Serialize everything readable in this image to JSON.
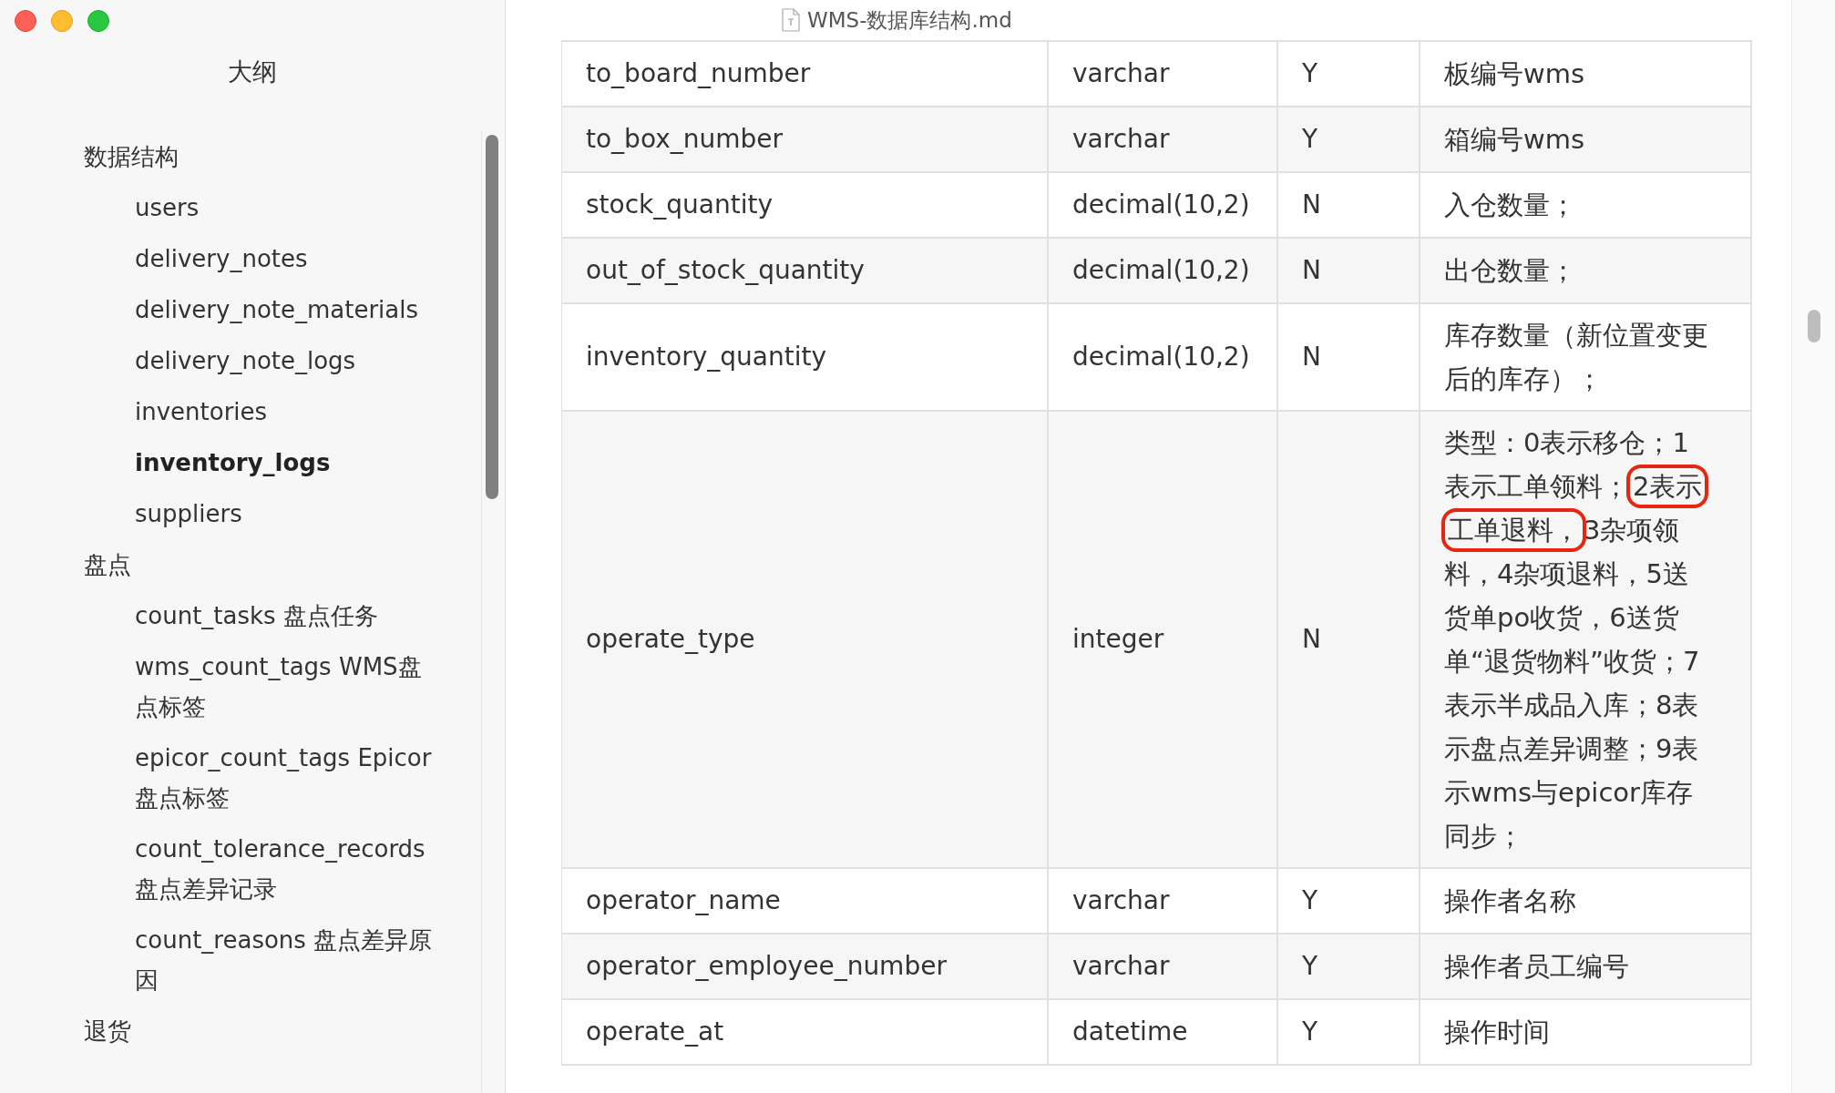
{
  "window": {
    "title": "WMS-数据库结构.md"
  },
  "sidebar": {
    "title": "大纲",
    "items": [
      {
        "label": "数据结构",
        "selected": false,
        "children": [
          {
            "label": "users",
            "selected": false
          },
          {
            "label": "delivery_notes",
            "selected": false
          },
          {
            "label": "delivery_note_materials",
            "selected": false
          },
          {
            "label": "delivery_note_logs",
            "selected": false
          },
          {
            "label": "inventories",
            "selected": false
          },
          {
            "label": "inventory_logs",
            "selected": true
          },
          {
            "label": "suppliers",
            "selected": false
          }
        ]
      },
      {
        "label": "盘点",
        "selected": false,
        "children": [
          {
            "label": "count_tasks 盘点任务",
            "selected": false
          },
          {
            "label": "wms_count_tags WMS盘点标签",
            "selected": false
          },
          {
            "label": "epicor_count_tags Epicor盘点标签",
            "selected": false
          },
          {
            "label": "count_tolerance_records 盘点差异记录",
            "selected": false
          },
          {
            "label": "count_reasons 盘点差异原因",
            "selected": false
          }
        ]
      },
      {
        "label": "退货",
        "selected": false
      }
    ]
  },
  "table": {
    "rows": [
      {
        "field": "to_board_number",
        "type": "varchar",
        "nullable": "Y",
        "description": "板编号wms"
      },
      {
        "field": "to_box_number",
        "type": "varchar",
        "nullable": "Y",
        "description": "箱编号wms"
      },
      {
        "field": "stock_quantity",
        "type": "decimal(10,2)",
        "nullable": "N",
        "description": "入仓数量；"
      },
      {
        "field": "out_of_stock_quantity",
        "type": "decimal(10,2)",
        "nullable": "N",
        "description": "出仓数量；"
      },
      {
        "field": "inventory_quantity",
        "type": "decimal(10,2)",
        "nullable": "N",
        "description": "库存数量（新位置变更后的库存）；"
      },
      {
        "field": "operate_type",
        "type": "integer",
        "nullable": "N",
        "description_parts": [
          {
            "text": "类型：0表示移仓；1表示工单领料；",
            "highlighted": false
          },
          {
            "text": "2表示",
            "highlighted": true
          },
          {
            "text": "工单退料，",
            "highlighted": true
          },
          {
            "text": "3杂项领料，4杂项退料，5送货单po收货，6送货单“退货物料”收货；7表示半成品入库；8表示盘点差异调整；9表示wms与epicor库存同步；",
            "highlighted": false
          }
        ]
      },
      {
        "field": "operator_name",
        "type": "varchar",
        "nullable": "Y",
        "description": "操作者名称"
      },
      {
        "field": "operator_employee_number",
        "type": "varchar",
        "nullable": "Y",
        "description": "操作者员工编号"
      },
      {
        "field": "operate_at",
        "type": "datetime",
        "nullable": "Y",
        "description": "操作时间"
      }
    ]
  }
}
